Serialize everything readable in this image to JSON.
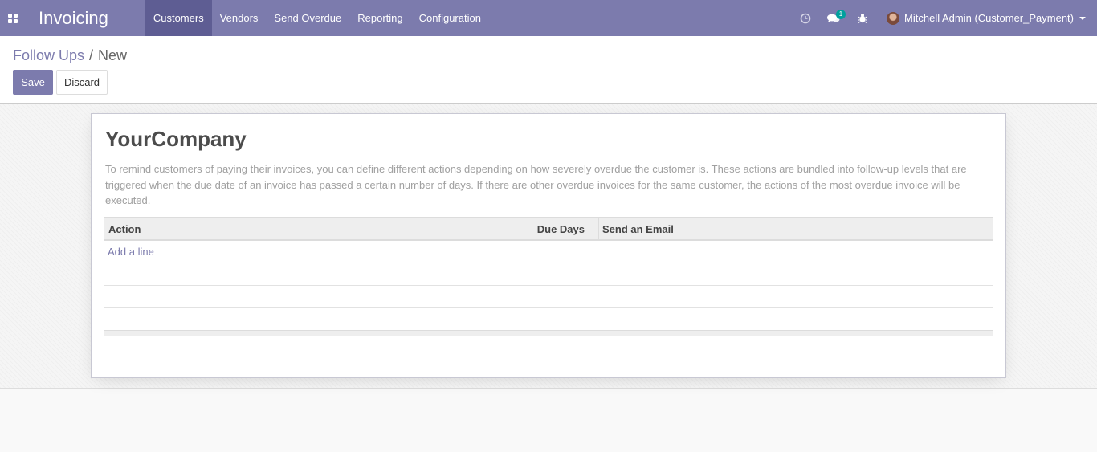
{
  "navbar": {
    "app_title": "Invoicing",
    "menu": [
      {
        "label": "Customers",
        "active": true
      },
      {
        "label": "Vendors",
        "active": false
      },
      {
        "label": "Send Overdue",
        "active": false
      },
      {
        "label": "Reporting",
        "active": false
      },
      {
        "label": "Configuration",
        "active": false
      }
    ],
    "systray": {
      "activity_icon": "clock-icon",
      "messages_icon": "chat-bubbles-icon",
      "messages_count": "1",
      "debug_icon": "bug-icon",
      "user_name": "Mitchell Admin (Customer_Payment)"
    },
    "colors": {
      "navbar_bg": "#7c7bad",
      "active_bg": "#5e5d93",
      "badge": "#00a09d"
    }
  },
  "breadcrumb": {
    "parent": "Follow Ups",
    "separator": "/",
    "current": "New"
  },
  "buttons": {
    "save": "Save",
    "discard": "Discard"
  },
  "form": {
    "company": "YourCompany",
    "help_text": "To remind customers of paying their invoices, you can define different actions depending on how severely overdue the customer is. These actions are bundled into follow-up levels that are triggered when the due date of an invoice has passed a certain number of days. If there are other overdue invoices for the same customer, the actions of the most overdue invoice will be executed.",
    "table": {
      "columns": [
        "Action",
        "Due Days",
        "Send an Email"
      ],
      "add_line": "Add a line"
    }
  }
}
